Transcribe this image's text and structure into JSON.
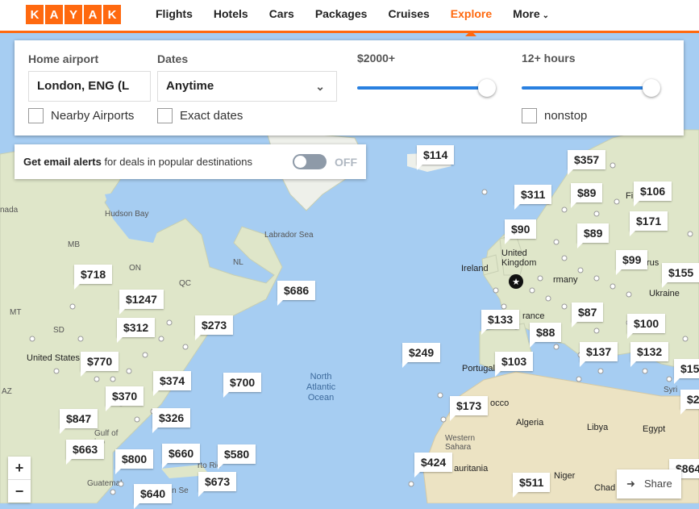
{
  "logo": {
    "letters": [
      "K",
      "A",
      "Y",
      "A",
      "K"
    ]
  },
  "nav": {
    "flights": "Flights",
    "hotels": "Hotels",
    "cars": "Cars",
    "packages": "Packages",
    "cruises": "Cruises",
    "explore": "Explore",
    "more": "More"
  },
  "filters": {
    "home_airport_label": "Home airport",
    "home_airport_value": "London, ENG (L",
    "dates_label": "Dates",
    "dates_value": "Anytime",
    "price_label": "$2000+",
    "price_level": 1.0,
    "duration_label": "12+ hours",
    "duration_level": 1.0,
    "nearby_airports": "Nearby Airports",
    "exact_dates": "Exact dates",
    "nonstop": "nonstop"
  },
  "alert": {
    "bold": "Get email alerts",
    "rest": " for deals in popular destinations",
    "toggle": "OFF"
  },
  "prices": [
    "$114",
    "$357",
    "$311",
    "$89",
    "$106",
    "$171",
    "$90",
    "$89",
    "$99",
    "$155",
    "$718",
    "$686",
    "$1247",
    "$312",
    "$273",
    "$133",
    "$87",
    "$100",
    "$88",
    "$249",
    "$770",
    "$103",
    "$137",
    "$132",
    "$374",
    "$700",
    "$370",
    "$173",
    "$326",
    "$847",
    "$663",
    "$800",
    "$660",
    "$580",
    "$424",
    "$673",
    "$640",
    "$511",
    "$15",
    "$2",
    "$864"
  ],
  "map_labels": {
    "hudson_bay": "Hudson Bay",
    "labrador_sea": "Labrador Sea",
    "ireland": "Ireland",
    "united_kingdom": "United\nKingdom",
    "ukraine": "Ukraine",
    "rmany": "rmany",
    "rance": "rance",
    "portugal": "Portugal",
    "united_states": "United States",
    "north_atlantic_ocean": "North\nAtlantic\nOcean",
    "algeria": "Algeria",
    "libya": "Libya",
    "egypt": "Egypt",
    "western_sahara": "Western\nSahara",
    "mauritania": "auritania",
    "niger": "Niger",
    "chad": "Chad",
    "gulf_of_mexico": "Gulf of\nico",
    "guatemala": "Guatemal",
    "nada": "nada",
    "mb": "MB",
    "on": "ON",
    "qc": "QC",
    "nl": "NL",
    "mt": "MT",
    "sd": "SD",
    "az": "AZ",
    "fi": "Fi",
    "rus": "rus",
    "occo": "occo",
    "syri": "Syri",
    "sea": "ean Se",
    "pr": "rto Ric"
  },
  "zoom": {
    "in": "+",
    "out": "−"
  },
  "share": {
    "icon": "share-icon",
    "label": "Share"
  },
  "colors": {
    "brand": "#ff690f",
    "accent": "#2980e0",
    "water": "#a6cdf2",
    "land": "#dfe6c9"
  }
}
